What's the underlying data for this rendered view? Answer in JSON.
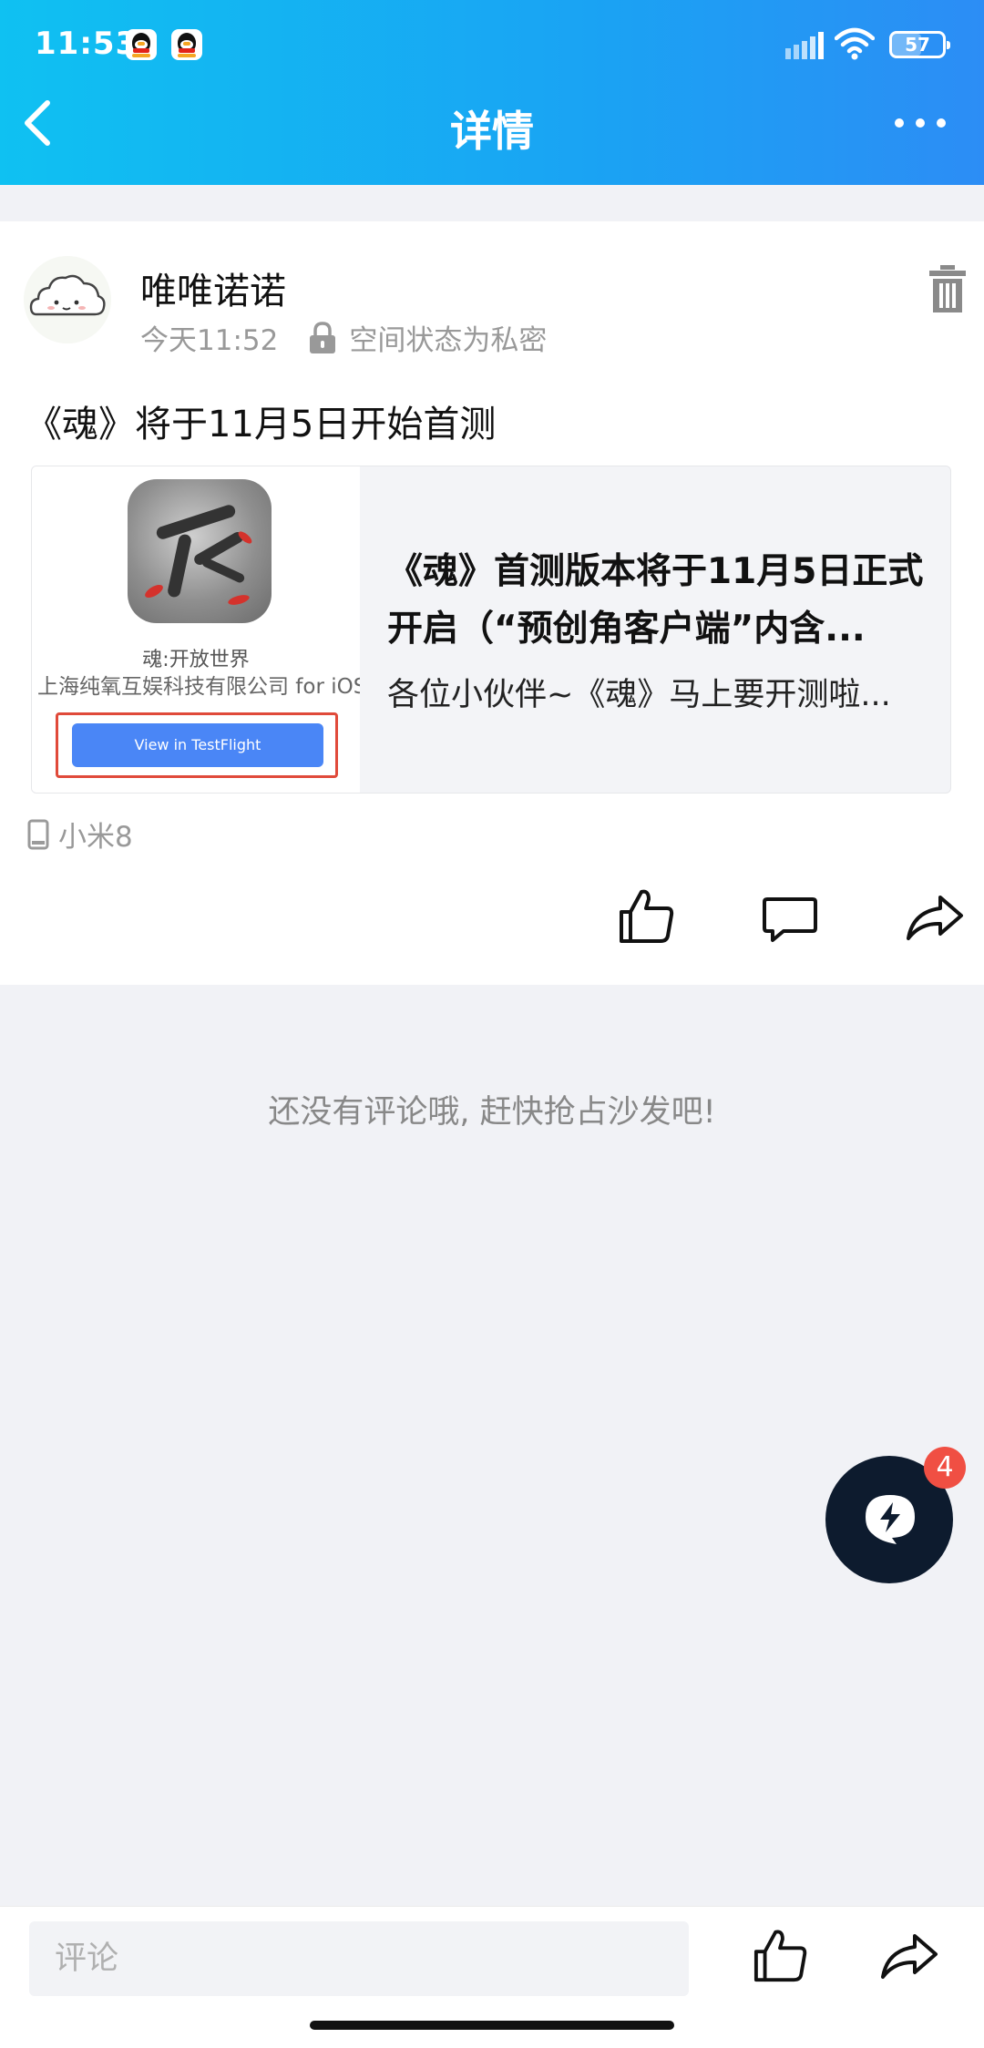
{
  "status_bar": {
    "time": "11:53",
    "battery": "57",
    "battery_percent": 57,
    "icons": [
      "qq-icon",
      "qq-icon",
      "signal-icon",
      "wifi-icon",
      "battery-icon"
    ]
  },
  "nav": {
    "title": "详情",
    "icons": [
      "back-icon",
      "more-icon"
    ]
  },
  "post": {
    "username": "唯唯诺诺",
    "time": "今天11:52",
    "privacy": "空间状态为私密",
    "text": "《魂》将于11月5日开始首测",
    "link": {
      "thumb_app_name": "魂:开放世界",
      "thumb_developer": "上海纯氧互娱科技有限公司 for iOS",
      "thumb_button": "View in TestFlight",
      "title": "《魂》首测版本将于11月5日正式开启（“预创角客户端”内含...",
      "desc": "各位小伙伴~《魂》马上要开测啦..."
    },
    "device": "小米8",
    "actions": [
      "like-icon",
      "comment-icon",
      "share-icon"
    ]
  },
  "comments": {
    "empty_text": "还没有评论哦, 赶快抢占沙发吧!"
  },
  "fab": {
    "badge": "4",
    "icon": "lightning-chat-icon"
  },
  "bottom_bar": {
    "placeholder": "评论",
    "actions": [
      "like-icon",
      "share-icon"
    ]
  },
  "colors": {
    "header_gradient_start": "#0fc1f2",
    "header_gradient_end": "#2c8df5",
    "badge": "#f04f43",
    "fab": "#0d1b2e",
    "testflight_button": "#4a86f6"
  }
}
